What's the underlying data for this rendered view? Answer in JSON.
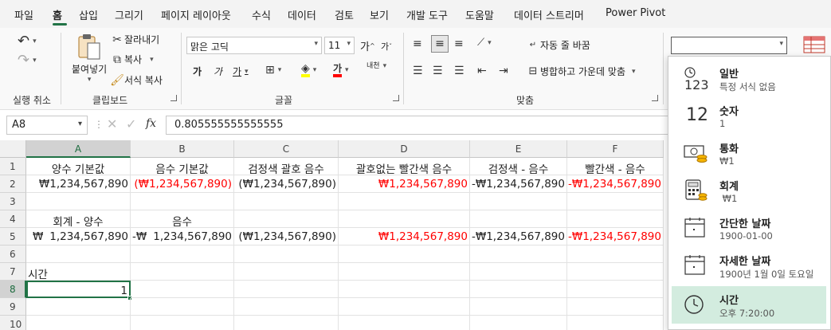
{
  "menu": {
    "tabs": [
      "파일",
      "홈",
      "삽입",
      "그리기",
      "페이지 레이아웃",
      "수식",
      "데이터",
      "검토",
      "보기",
      "개발 도구",
      "도움말",
      "데이터 스트리머",
      "Power Pivot"
    ],
    "active": "홈"
  },
  "ribbon": {
    "undo_group_label": "실행 취소",
    "clipboard": {
      "paste_label": "붙여넣기",
      "cut_label": "잘라내기",
      "copy_label": "복사",
      "format_painter_label": "서식 복사",
      "group_label": "클립보드"
    },
    "font": {
      "font_name": "맑은 고딕",
      "font_size": "11",
      "increase_glyph": "가",
      "decrease_glyph": "가",
      "bold_glyph": "가",
      "italic_glyph": "가",
      "underline_glyph": "가",
      "font_color_glyph": "가",
      "phonetic_glyph": "내천",
      "group_label": "글꼴"
    },
    "alignment": {
      "wrap_text_label": "자동 줄 바꿈",
      "merge_center_label": "병합하고 가운데 맞춤",
      "group_label": "맞춤"
    },
    "number": {
      "format_value": ""
    }
  },
  "formula_bar": {
    "name_box": "A8",
    "fx_label": "fx",
    "formula": "0.805555555555555"
  },
  "columns": [
    "A",
    "B",
    "C",
    "D",
    "E",
    "F"
  ],
  "rows": [
    "1",
    "2",
    "3",
    "4",
    "5",
    "6",
    "7",
    "8",
    "9",
    "10"
  ],
  "cells": {
    "A1": "양수 기본값",
    "B1": "음수 기본값",
    "C1": "검정색 괄호 음수",
    "D1": "괄호없는 빨간색 음수",
    "E1": "검정색 - 음수",
    "F1": "빨간색 - 음수",
    "A2": "₩1,234,567,890",
    "B2": "(₩1,234,567,890)",
    "C2": "(₩1,234,567,890)",
    "D2": "₩1,234,567,890",
    "E2": "-₩1,234,567,890",
    "F2": "-₩1,234,567,890",
    "A4": "회계 - 양수",
    "B4": "음수",
    "A5_symbol": "₩",
    "A5_value": "1,234,567,890",
    "B5_symbol": "-₩",
    "B5_value": "1,234,567,890",
    "C5": "(₩1,234,567,890)",
    "D5": "₩1,234,567,890",
    "E5": "-₩1,234,567,890",
    "F5": "-₩1,234,567,890",
    "A7": "시간",
    "A8": "1"
  },
  "colors": {
    "accent": "#217346",
    "negative_red": "#ff0000",
    "selected_item_bg": "#d3ecdf"
  },
  "number_format_dropdown": [
    {
      "label": "일반",
      "sample": "특정 서식 없음",
      "icon": "general-123-icon"
    },
    {
      "label": "숫자",
      "sample": "1",
      "icon": "number-12-icon",
      "icon_text": "12"
    },
    {
      "label": "통화",
      "sample": "₩1",
      "icon": "currency-icon"
    },
    {
      "label": "회계",
      "sample": " ₩1",
      "icon": "accounting-icon"
    },
    {
      "label": "간단한 날짜",
      "sample": "1900-01-00",
      "icon": "short-date-icon"
    },
    {
      "label": "자세한 날짜",
      "sample": "1900년 1월 0일 토요일",
      "icon": "long-date-icon"
    },
    {
      "label": "시간",
      "sample": "오후 7:20:00",
      "icon": "time-icon"
    }
  ],
  "icon_123_text": "123"
}
